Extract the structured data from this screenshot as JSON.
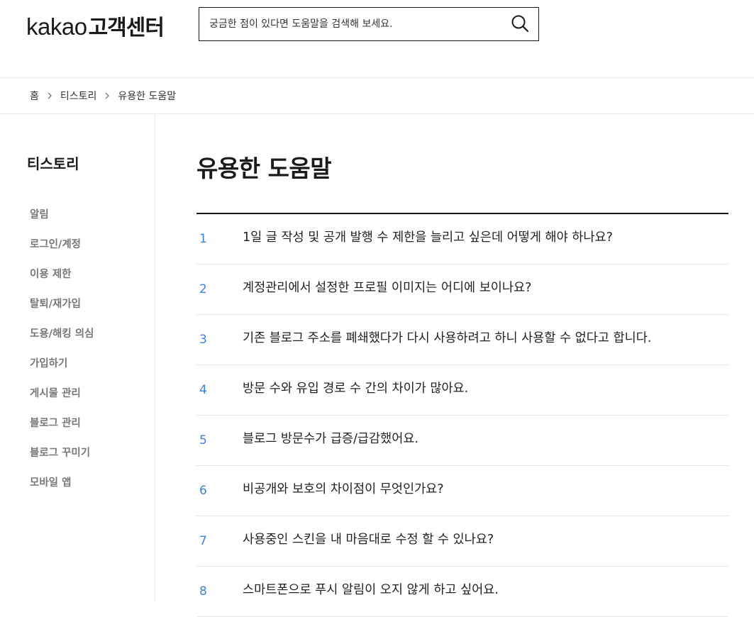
{
  "header": {
    "logo_brand": "kakao",
    "logo_service": "고객센터",
    "search_placeholder": "궁금한 점이 있다면 도움말을 검색해 보세요."
  },
  "breadcrumb": [
    "홈",
    "티스토리",
    "유용한 도움말"
  ],
  "sidebar": {
    "title": "티스토리",
    "items": [
      "알림",
      "로그인/계정",
      "이용 제한",
      "탈퇴/재가입",
      "도용/해킹 의심",
      "가입하기",
      "게시물 관리",
      "블로그 관리",
      "블로그 꾸미기",
      "모바일 앱"
    ]
  },
  "main": {
    "title": "유용한 도움말",
    "faqs": [
      {
        "num": "1",
        "text": "1일 글 작성 및 공개 발행 수 제한을 늘리고 싶은데 어떻게 해야 하나요?"
      },
      {
        "num": "2",
        "text": "계정관리에서 설정한 프로필 이미지는 어디에 보이나요?"
      },
      {
        "num": "3",
        "text": "기존 블로그 주소를 폐쇄했다가 다시 사용하려고 하니 사용할 수 없다고 합니다."
      },
      {
        "num": "4",
        "text": "방문 수와 유입 경로 수 간의 차이가 많아요."
      },
      {
        "num": "5",
        "text": "블로그 방문수가 급증/급감했어요."
      },
      {
        "num": "6",
        "text": "비공개와 보호의 차이점이 무엇인가요?"
      },
      {
        "num": "7",
        "text": "사용중인 스킨을 내 마음대로 수정 할 수 있나요?"
      },
      {
        "num": "8",
        "text": "스마트폰으로 푸시 알림이 오지 않게 하고 싶어요."
      }
    ]
  }
}
